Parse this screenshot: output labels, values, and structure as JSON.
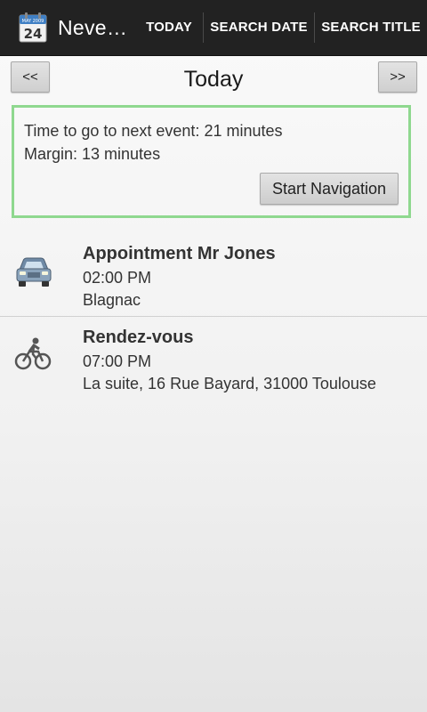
{
  "app": {
    "title": "Neve…",
    "icon_month": "MAY 2009",
    "icon_day": "24"
  },
  "actionbar": {
    "today": "TODAY",
    "search_date": "SEARCH DATE",
    "search_title": "SEARCH TITLE"
  },
  "day_nav": {
    "prev_label": "<<",
    "next_label": ">>",
    "title": "Today"
  },
  "next_event": {
    "time_to_next": "Time to go to next event: 21 minutes",
    "margin": "Margin: 13 minutes",
    "start_button": "Start Navigation",
    "border_color": "#8fd88f"
  },
  "events": [
    {
      "icon": "car-icon",
      "title": "Appointment Mr Jones",
      "time": "02:00 PM",
      "place": "Blagnac"
    },
    {
      "icon": "bicycle-icon",
      "title": "Rendez-vous",
      "time": "07:00 PM",
      "place": "La suite, 16 Rue Bayard, 31000 Toulouse"
    }
  ]
}
